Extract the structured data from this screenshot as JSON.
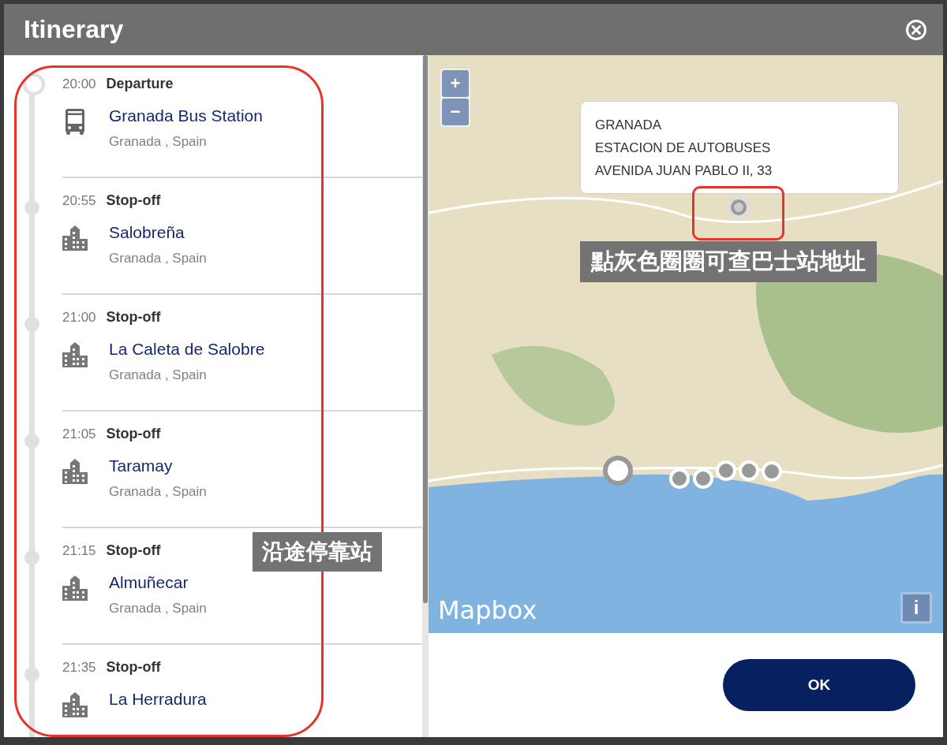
{
  "window": {
    "title": "Itinerary"
  },
  "stops": [
    {
      "time": "20:00",
      "type": "Departure",
      "kind": "departure",
      "name": "Granada Bus Station",
      "location": "Granada , Spain"
    },
    {
      "time": "20:55",
      "type": "Stop-off",
      "kind": "stop",
      "name": "Salobreña",
      "location": "Granada , Spain"
    },
    {
      "time": "21:00",
      "type": "Stop-off",
      "kind": "stop",
      "name": "La Caleta de Salobre",
      "location": "Granada , Spain"
    },
    {
      "time": "21:05",
      "type": "Stop-off",
      "kind": "stop",
      "name": "Taramay",
      "location": "Granada , Spain"
    },
    {
      "time": "21:15",
      "type": "Stop-off",
      "kind": "stop",
      "name": "Almuñecar",
      "location": "Granada , Spain"
    },
    {
      "time": "21:35",
      "type": "Stop-off",
      "kind": "stop",
      "name": "La Herradura"
    }
  ],
  "map": {
    "zoom_in": "+",
    "zoom_out": "−",
    "popup": [
      "GRANADA",
      "ESTACION DE AUTOBUSES",
      "AVENIDA JUAN PABLO II, 33"
    ],
    "attribution": "Mapbox",
    "info": "i"
  },
  "annotations": {
    "list_note": "沿途停靠站",
    "map_note": "點灰色圈圈可查巴士站地址"
  },
  "buttons": [
    "OK"
  ]
}
